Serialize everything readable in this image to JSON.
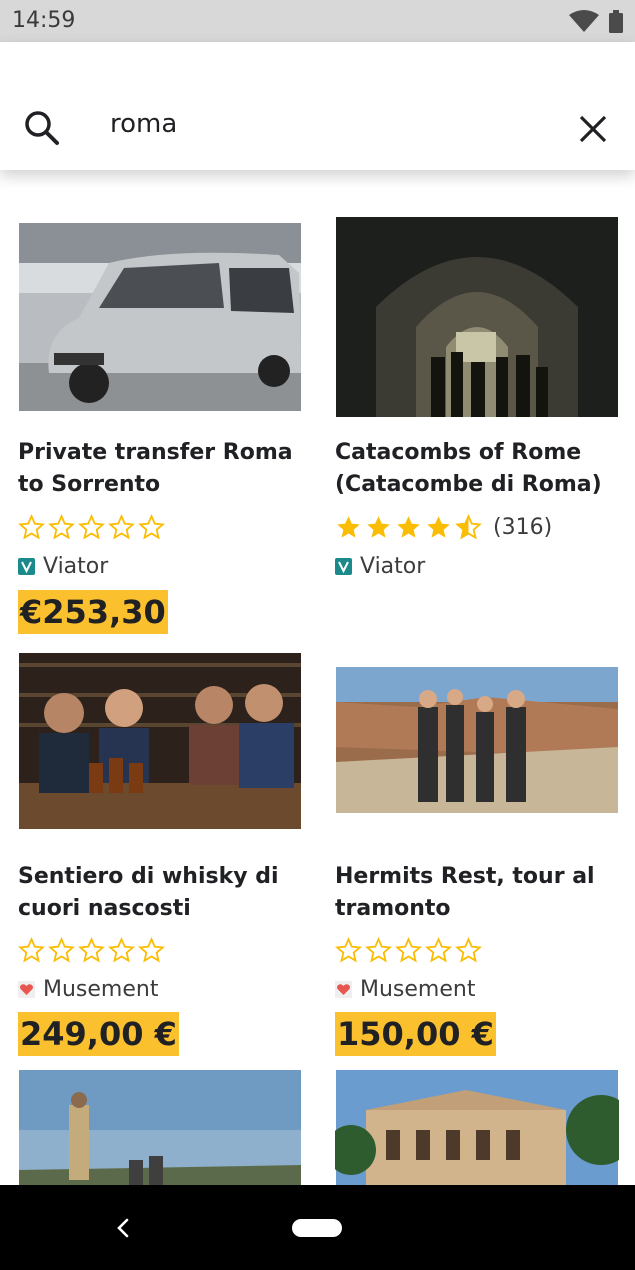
{
  "status_bar": {
    "time": "14:59"
  },
  "search": {
    "query": "roma"
  },
  "results": [
    {
      "title": "Private transfer Roma to Sorrento",
      "rating_stars": 0,
      "review_count": "",
      "provider": "Viator",
      "price": "€253,30"
    },
    {
      "title": "Catacombs of Rome (Catacombe di Roma)",
      "rating_stars": 4.5,
      "review_count": "(316)",
      "provider": "Viator",
      "price": ""
    },
    {
      "title": "Sentiero di whisky di cuori nascosti",
      "rating_stars": 0,
      "review_count": "",
      "provider": "Musement",
      "price": "249,00 €"
    },
    {
      "title": "Hermits Rest, tour al tramonto",
      "rating_stars": 0,
      "review_count": "",
      "provider": "Musement",
      "price": "150,00 €"
    },
    {
      "title": "",
      "provider": "",
      "price": ""
    },
    {
      "title": "",
      "provider": "",
      "price": ""
    }
  ],
  "colors": {
    "accent_price": "#fbc02d",
    "star": "#fbbc04"
  }
}
